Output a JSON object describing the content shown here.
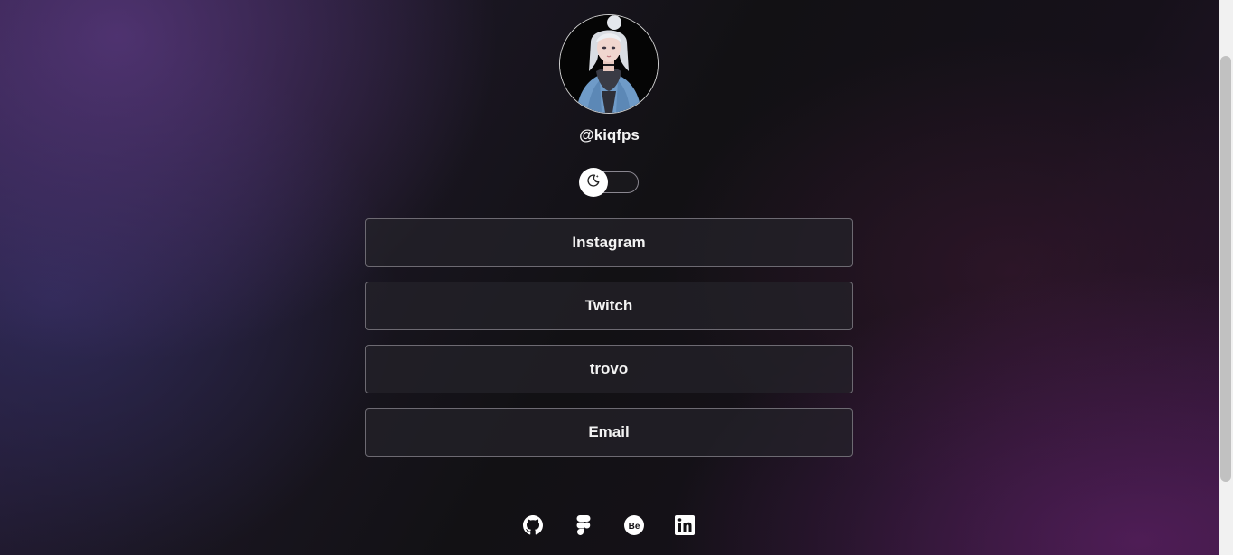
{
  "profile": {
    "username": "@kiqfps",
    "avatar_icon": "profile-avatar-illustration"
  },
  "theme_toggle": {
    "icon": "moon-icon",
    "state": "dark"
  },
  "links": [
    {
      "label": "Instagram"
    },
    {
      "label": "Twitch"
    },
    {
      "label": "trovo"
    },
    {
      "label": "Email"
    }
  ],
  "socials": [
    {
      "icon": "github-icon"
    },
    {
      "icon": "figma-icon"
    },
    {
      "icon": "behance-icon"
    },
    {
      "icon": "linkedin-icon"
    }
  ],
  "colors": {
    "text": "#ffffff",
    "button_border": "#6d6a72",
    "accent_purple": "#5c3a82"
  }
}
